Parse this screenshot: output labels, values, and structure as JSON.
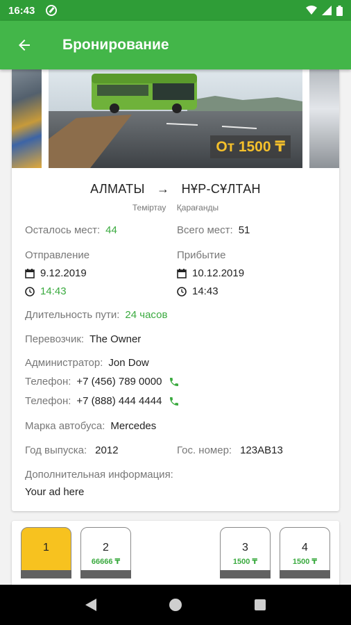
{
  "status_bar": {
    "time": "16:43"
  },
  "app_bar": {
    "title": "Бронирование"
  },
  "gallery": {
    "price_badge": "От 1500 ₸"
  },
  "route": {
    "from": "АЛМАТЫ",
    "to": "НҰР-СҰЛТАН",
    "via_from": "Теміртау",
    "via_to": "Қарағанды"
  },
  "details": {
    "seats_left_label": "Осталось мест:",
    "seats_left": "44",
    "seats_total_label": "Всего мест:",
    "seats_total": "51",
    "departure_label": "Отправление",
    "departure_date": "9.12.2019",
    "departure_time": "14:43",
    "arrival_label": "Прибытие",
    "arrival_date": "10.12.2019",
    "arrival_time": "14:43",
    "duration_label": "Длительность пути:",
    "duration": "24 часов",
    "carrier_label": "Перевозчик:",
    "carrier": "The Owner",
    "admin_label": "Администратор:",
    "admin": "Jon Dow",
    "phone_label": "Телефон:",
    "phone1": "+7 (456) 789 0000",
    "phone2": "+7 (888) 444 4444",
    "bus_brand_label": "Марка автобуса:",
    "bus_brand": "Mercedes",
    "year_label": "Год выпуска:",
    "year": "2012",
    "plate_label": "Гос. номер:",
    "plate": "123АВ13",
    "extra_label": "Дополнительная информация:",
    "extra": "Your ad here"
  },
  "seats": [
    {
      "number": "1",
      "price": "",
      "selected": true
    },
    {
      "number": "2",
      "price": "66666 ₸",
      "selected": false
    },
    {
      "number": "3",
      "price": "1500 ₸",
      "selected": false
    },
    {
      "number": "4",
      "price": "1500 ₸",
      "selected": false
    }
  ],
  "colors": {
    "status_bar": "#2f9d37",
    "app_bar": "#43b649",
    "accent_green": "#3aaa3f",
    "price_yellow": "#f5c02b",
    "seat_selected": "#f7c21f"
  }
}
